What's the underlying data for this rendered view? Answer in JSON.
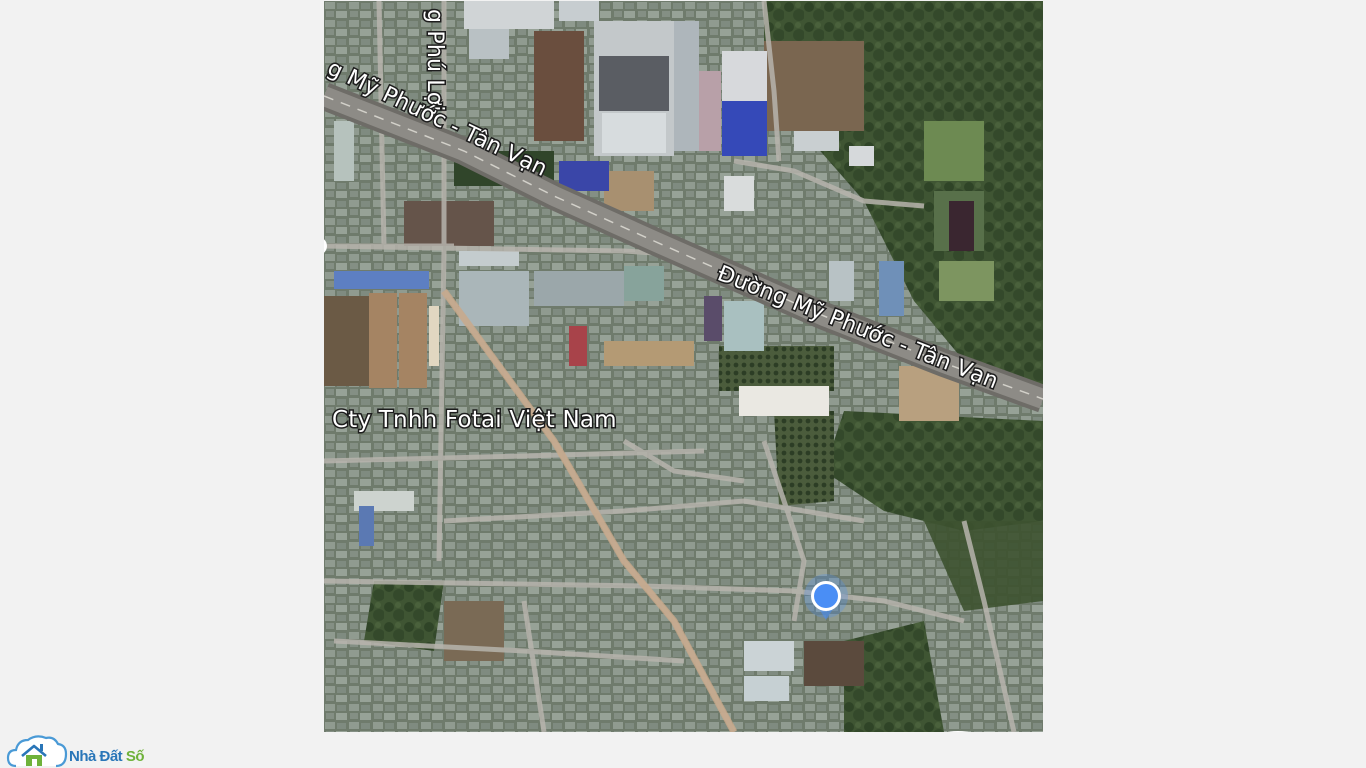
{
  "map": {
    "roads": {
      "main_road_label": "Đường Mỹ Phước - Tân Vạn",
      "main_road_label_partial": "g Mỹ Phước - Tân Vạn",
      "side_road_label_partial": "g Phú Lợi"
    },
    "poi": {
      "company_label_partial": "Cty Tnhh Fotai Việt Nam"
    },
    "location_marker": {
      "color": "#4a8ef5"
    },
    "imagery": "satellite"
  },
  "watermark": {
    "brand_part_a": "Nhà Đất",
    "brand_part_b": "Số",
    "brand_color_a": "#2a76b8",
    "brand_color_b": "#6fb23a"
  }
}
